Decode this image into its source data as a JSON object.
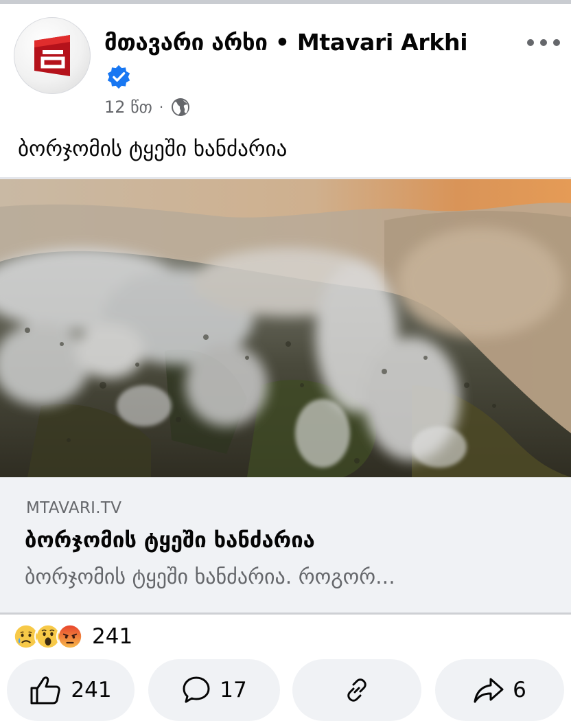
{
  "post": {
    "page_name": "მთავარი არხი • Mtavari Arkhi",
    "time": "12 წთ",
    "meta_separator": "·",
    "audience_icon": "globe-icon",
    "verified_icon": "verified-badge-icon",
    "more_icon": "more-horizontal-icon",
    "text": "ბორჯომის ტყეში ხანძარია"
  },
  "link_preview": {
    "domain": "MTAVARI.TV",
    "title": "ბორჯომის ტყეში ხანძარია",
    "description": "ბორჯომის ტყეში ხანძარია. როგორ..."
  },
  "reactions": {
    "icons": [
      "sad-reaction-icon",
      "wow-reaction-icon",
      "angry-reaction-icon"
    ],
    "count": "241"
  },
  "actions": {
    "like_count": "241",
    "comment_count": "17",
    "share_count": "6"
  },
  "colors": {
    "verified": "#1877f2",
    "secondary_text": "#65676b",
    "link_background": "#f0f2f5",
    "brand_red": "#c8102e"
  }
}
